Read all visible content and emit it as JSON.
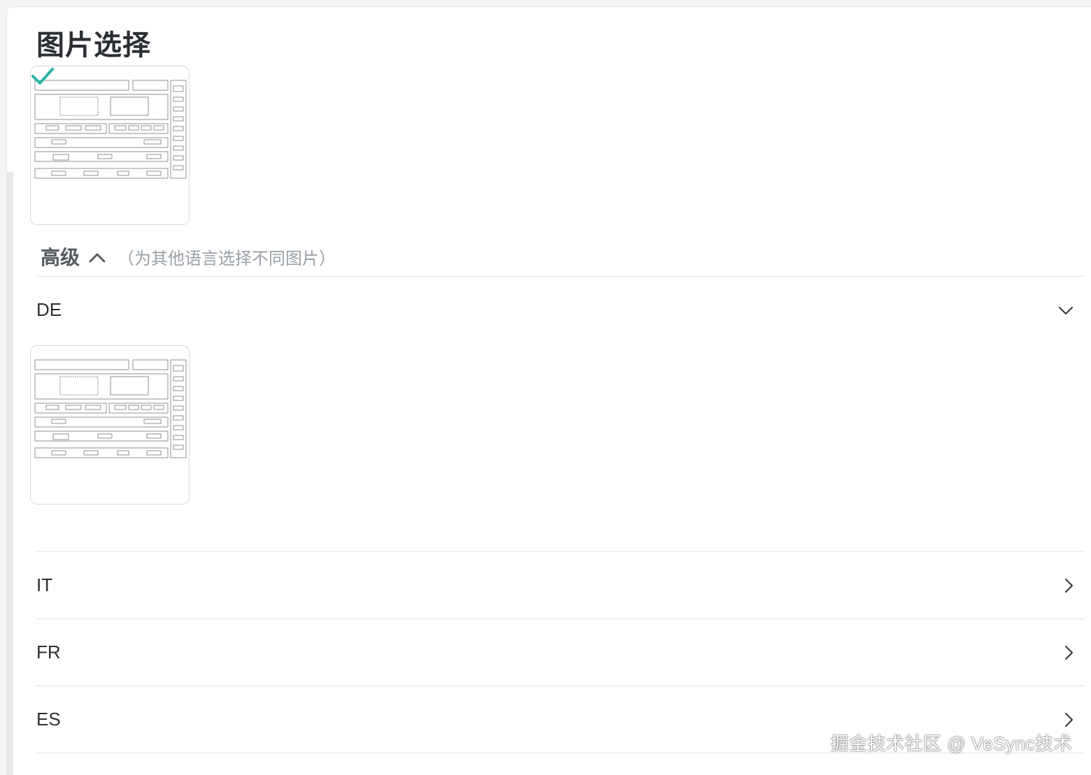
{
  "page": {
    "title": "图片选择"
  },
  "main_image": {
    "selected": true
  },
  "advanced": {
    "label": "高级",
    "hint": "（为其他语言选择不同图片）",
    "expanded": true
  },
  "languages": [
    {
      "code": "DE",
      "expanded": true
    },
    {
      "code": "IT",
      "expanded": false
    },
    {
      "code": "FR",
      "expanded": false
    },
    {
      "code": "ES",
      "expanded": false
    }
  ],
  "watermark": "掘金技术社区 @ VeSync技术",
  "colors": {
    "check": "#2bb3a8",
    "title": "#2b2f33",
    "divider": "#e3e5e8"
  }
}
